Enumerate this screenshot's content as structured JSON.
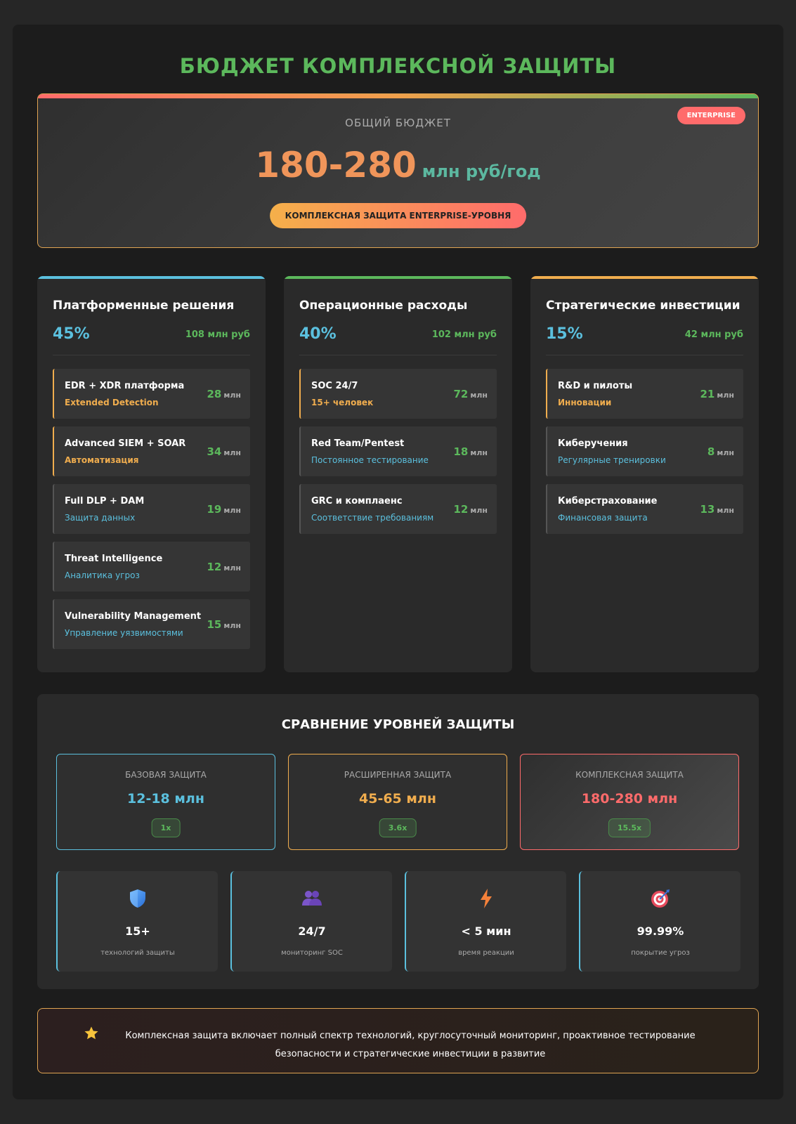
{
  "title": "БЮДЖЕТ КОМПЛЕКСНОЙ ЗАЩИТЫ",
  "total": {
    "label": "ОБЩИЙ БЮДЖЕТ",
    "badge": "ENTERPRISE",
    "amount": "180-280",
    "unit": "млн руб/год",
    "pill": "КОМПЛЕКСНАЯ ЗАЩИТА ENTERPRISE-УРОВНЯ"
  },
  "categories": [
    {
      "title": "Платформенные решения",
      "percent": "45%",
      "sum": "108 млн руб",
      "accent_color": "#5bc0de",
      "items": [
        {
          "name": "EDR + XDR платформа",
          "desc": "Extended Detection",
          "value": "28",
          "unit": "млн",
          "accent": true
        },
        {
          "name": "Advanced SIEM + SOAR",
          "desc": "Автоматизация",
          "value": "34",
          "unit": "млн",
          "accent": true
        },
        {
          "name": "Full DLP + DAM",
          "desc": "Защита данных",
          "value": "19",
          "unit": "млн",
          "accent": false
        },
        {
          "name": "Threat Intelligence",
          "desc": "Аналитика угроз",
          "value": "12",
          "unit": "млн",
          "accent": false
        },
        {
          "name": "Vulnerability Management",
          "desc": "Управление уязвимостями",
          "value": "15",
          "unit": "млн",
          "accent": false
        }
      ]
    },
    {
      "title": "Операционные расходы",
      "percent": "40%",
      "sum": "102 млн руб",
      "accent_color": "#5cb85c",
      "items": [
        {
          "name": "SOC 24/7",
          "desc": "15+ человек",
          "value": "72",
          "unit": "млн",
          "accent": true
        },
        {
          "name": "Red Team/Pentest",
          "desc": "Постоянное тестирование",
          "value": "18",
          "unit": "млн",
          "accent": false
        },
        {
          "name": "GRC и комплаенс",
          "desc": "Соответствие требованиям",
          "value": "12",
          "unit": "млн",
          "accent": false
        }
      ]
    },
    {
      "title": "Стратегические инвестиции",
      "percent": "15%",
      "sum": "42 млн руб",
      "accent_color": "#f0ad4e",
      "items": [
        {
          "name": "R&D и пилоты",
          "desc": "Инновации",
          "value": "21",
          "unit": "млн",
          "accent": true
        },
        {
          "name": "Киберучения",
          "desc": "Регулярные тренировки",
          "value": "8",
          "unit": "млн",
          "accent": false
        },
        {
          "name": "Киберстрахование",
          "desc": "Финансовая защита",
          "value": "13",
          "unit": "млн",
          "accent": false
        }
      ]
    }
  ],
  "comparison": {
    "title": "СРАВНЕНИЕ УРОВНЕЙ ЗАЩИТЫ",
    "levels": [
      {
        "name": "БАЗОВАЯ ЗАЩИТА",
        "value": "12-18 млн",
        "multiplier": "1x",
        "color": "#5bc0de"
      },
      {
        "name": "РАСШИРЕННАЯ ЗАЩИТА",
        "value": "45-65 млн",
        "multiplier": "3.6x",
        "color": "#f0ad4e"
      },
      {
        "name": "КОМПЛЕКСНАЯ ЗАЩИТА",
        "value": "180-280 млн",
        "multiplier": "15.5x",
        "color": "#ff6b6b"
      }
    ],
    "metrics": [
      {
        "icon": "shield-icon",
        "value": "15+",
        "label": "технологий защиты"
      },
      {
        "icon": "team-icon",
        "value": "24/7",
        "label": "мониторинг SOC"
      },
      {
        "icon": "lightning-icon",
        "value": "< 5 мин",
        "label": "время реакции"
      },
      {
        "icon": "target-icon",
        "value": "99.99%",
        "label": "покрытие угроз"
      }
    ]
  },
  "note": {
    "icon": "star-icon",
    "text": "Комплексная защита включает полный спектр технологий, круглосуточный мониторинг, проактивное тестирование безопасности и стратегические инвестиции в развитие"
  }
}
